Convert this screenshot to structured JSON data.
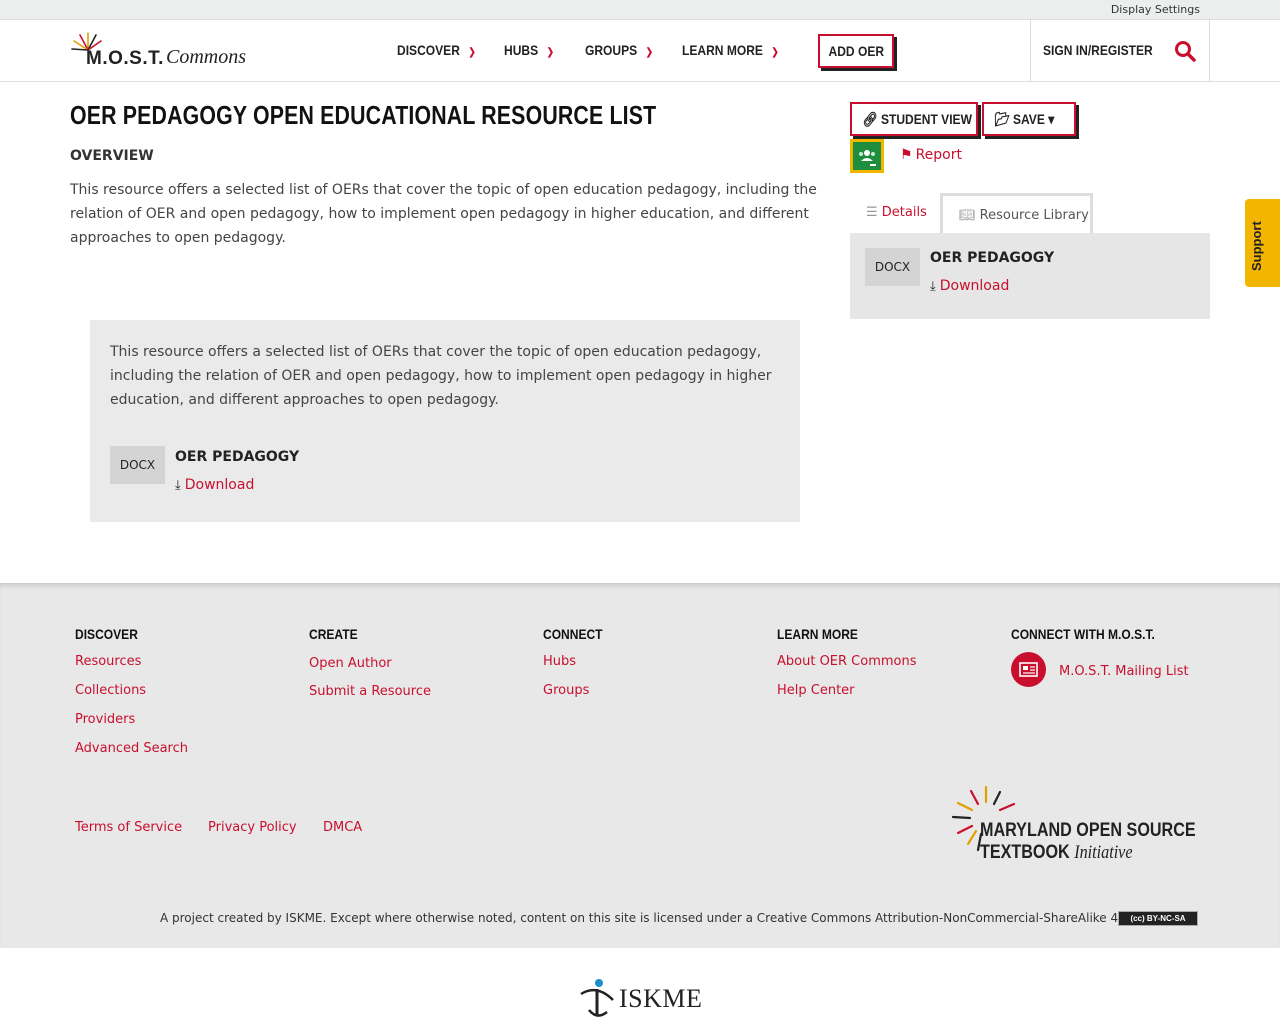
{
  "util": {
    "display_settings": "Display Settings"
  },
  "header": {
    "logo_part1": "M.O.S.T.",
    "logo_part2": "Commons",
    "nav": [
      {
        "label": "DISCOVER"
      },
      {
        "label": "HUBS"
      },
      {
        "label": "GROUPS"
      },
      {
        "label": "LEARN MORE"
      }
    ],
    "add_oer": "ADD OER",
    "sign_in": "SIGN IN/REGISTER"
  },
  "main": {
    "title": "OER PEDAGOGY OPEN EDUCATIONAL RESOURCE LIST",
    "overview_heading": "OVERVIEW",
    "overview_text": "This resource offers a selected list of OERs that cover the topic of open education pedagogy, including the relation of OER and open pedagogy, how to implement open pedagogy in higher education, and different approaches to open pedagogy.",
    "box": {
      "description": "This resource offers a selected list of OERs that cover the topic of open education pedagogy, including the relation of OER and open pedagogy, how to implement open pedagogy in higher education, and different approaches to open pedagogy.",
      "file_type": "DOCX",
      "file_name": "OER PEDAGOGY",
      "download": "Download"
    }
  },
  "sidebar": {
    "student_view": "STUDENT VIEW",
    "save": "SAVE",
    "report": "Report",
    "tabs": {
      "details": "Details",
      "library": "Resource Library"
    },
    "file_type": "DOCX",
    "file_name": "OER PEDAGOGY",
    "download": "Download"
  },
  "support": "Support",
  "footer": {
    "discover": {
      "heading": "DISCOVER",
      "links": [
        "Resources",
        "Collections",
        "Providers",
        "Advanced Search"
      ]
    },
    "create": {
      "heading": "CREATE",
      "links": [
        "Open Author",
        "Submit a Resource"
      ]
    },
    "connect": {
      "heading": "CONNECT",
      "links": [
        "Hubs",
        "Groups"
      ]
    },
    "learn_more": {
      "heading": "LEARN MORE",
      "links": [
        "About OER Commons",
        "Help Center"
      ]
    },
    "connect_most": {
      "heading": "CONNECT WITH M.O.S.T.",
      "mailing": "M.O.S.T. Mailing List"
    },
    "legal": [
      "Terms of Service",
      "Privacy Policy",
      "DMCA"
    ],
    "most_logo": {
      "line1": "MARYLAND OPEN SOURCE",
      "line2a": "TEXTBOOK",
      "line2b": "Initiative"
    },
    "license": "A project created by ISKME. Except where otherwise noted, content on this site is licensed under a Creative Commons Attribution-NonCommercial-ShareAlike 4.0 License.",
    "cc_badge": "(cc) BY-NC-SA"
  },
  "bottom": {
    "iskme": "ISKME"
  },
  "colors": {
    "accent": "#c8102e",
    "support": "#f2b600",
    "classroom": "#1e8e3e"
  }
}
